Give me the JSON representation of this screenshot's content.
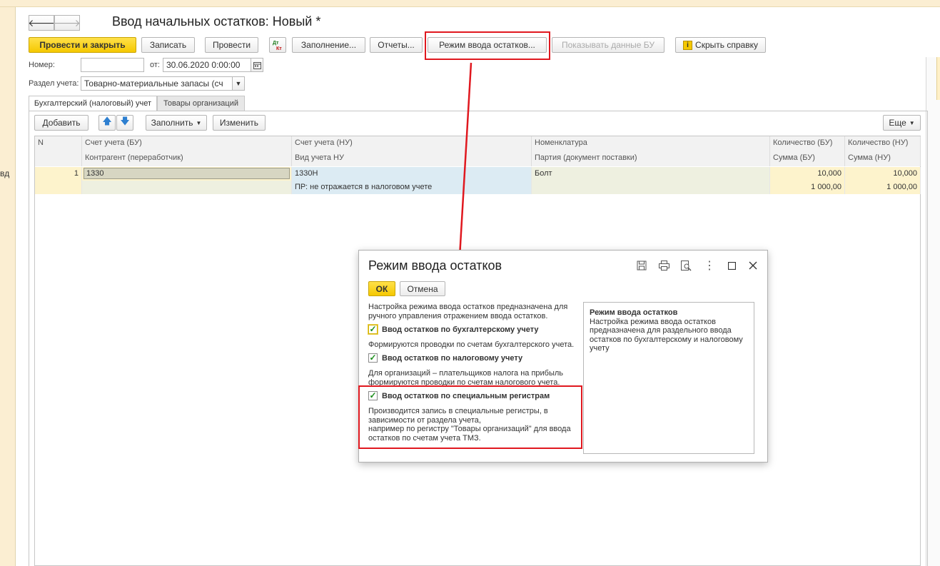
{
  "window": {
    "title": "Ввод начальных остатков: Новый *"
  },
  "toolbar": {
    "post_close": "Провести и закрыть",
    "save": "Записать",
    "post": "Провести",
    "dtkt_icon": "dt-kt-icon",
    "fill": "Заполнение...",
    "reports": "Отчеты...",
    "mode": "Режим ввода остатков...",
    "show_bu": "Показывать данные БУ",
    "hide_help": "Скрыть справку"
  },
  "form": {
    "number_label": "Номер:",
    "number_value": "",
    "date_label": "от:",
    "date_value": "30.06.2020  0:00:00",
    "section_label": "Раздел учета:",
    "section_value": "Товарно-материальные запасы (сч"
  },
  "tabs": [
    "Бухгалтерский (налоговый) учет",
    "Товары организаций"
  ],
  "table_toolbar": {
    "add": "Добавить",
    "fill": "Заполнить",
    "change": "Изменить",
    "more": "Еще"
  },
  "table": {
    "headers_row1": [
      "N",
      "Счет учета (БУ)",
      "Счет учета (НУ)",
      "Номенклатура",
      "Количество (БУ)",
      "Количество (НУ)"
    ],
    "headers_row2": [
      "",
      "Контрагент (переработчик)",
      "Вид учета НУ",
      "Партия (документ поставки)",
      "Сумма (БУ)",
      "Сумма (НУ)"
    ],
    "rows": [
      {
        "line1": [
          "1",
          "1330",
          "1330Н",
          "Болт",
          "10,000",
          "10,000"
        ],
        "line2": [
          "",
          "",
          "ПР: не отражается в налоговом учете",
          "",
          "1 000,00",
          "1 000,00"
        ]
      }
    ]
  },
  "dialog": {
    "title": "Режим ввода остатков",
    "ok": "ОК",
    "cancel": "Отмена",
    "intro": [
      "Настройка режима ввода остатков предназначена для",
      "ручного управления отражением  ввода остатков."
    ],
    "options": [
      {
        "label": "Ввод остатков по бухгалтерскому учету",
        "checked": true,
        "desc": [
          "Формируются проводки по счетам бухгалтерского учета."
        ]
      },
      {
        "label": "Ввод остатков по налоговому учету",
        "checked": true,
        "desc": [
          "Для организаций – плательщиков налога на прибыль",
          "формируются проводки по счетам налогового учета."
        ]
      },
      {
        "label": "Ввод остатков по специальным регистрам",
        "checked": true,
        "desc": [
          "Производится запись в специальные регистры, в",
          "зависимости от раздела учета,",
          "например по регистру \"Товары организаций\" для ввода",
          "остатков по счетам учета ТМЗ."
        ]
      }
    ],
    "help_title": "Режим ввода остатков",
    "help_text": [
      "Настройка режима ввода остатков",
      "предназначена для раздельного ввода",
      "остатков по бухгалтерскому и налоговому",
      "учету"
    ]
  },
  "left_cut_text": "вд",
  "colors": {
    "accent_yellow": "#f5c800",
    "highlight_red": "#e0181f",
    "row_yellow": "#fdf3cc",
    "row_blue": "#dcebf3",
    "row_olive": "#eef0e0"
  }
}
